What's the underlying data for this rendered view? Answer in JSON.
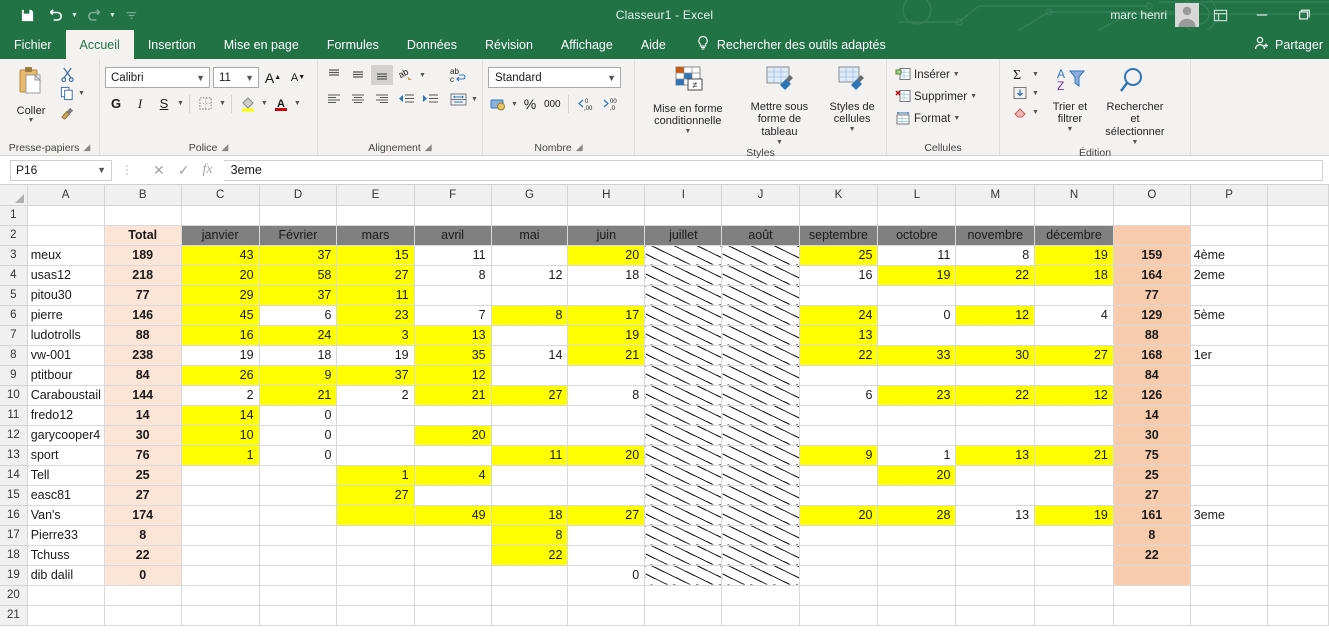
{
  "window": {
    "title": "Classeur1  -  Excel",
    "user": "marc henri",
    "qat": [
      {
        "name": "save",
        "label": "Enregistrer"
      },
      {
        "name": "undo",
        "label": "Annuler"
      },
      {
        "name": "redo",
        "label": "Rétablir"
      },
      {
        "name": "customize",
        "label": "Personnaliser la barre d'outils Accès rapide"
      }
    ],
    "controls": [
      {
        "name": "ribbon-display-options",
        "label": "Options d'affichage du ruban"
      },
      {
        "name": "minimize",
        "label": "Réduire"
      },
      {
        "name": "maximize",
        "label": "Agrandir"
      }
    ]
  },
  "tabs": [
    {
      "label": "Fichier",
      "active": false
    },
    {
      "label": "Accueil",
      "active": true
    },
    {
      "label": "Insertion",
      "active": false
    },
    {
      "label": "Mise en page",
      "active": false
    },
    {
      "label": "Formules",
      "active": false
    },
    {
      "label": "Données",
      "active": false
    },
    {
      "label": "Révision",
      "active": false
    },
    {
      "label": "Affichage",
      "active": false
    },
    {
      "label": "Aide",
      "active": false
    }
  ],
  "tellme": "Rechercher des outils adaptés",
  "share": "Partager",
  "ribbon": {
    "clipboard": {
      "group_label": "Presse-papiers",
      "paste": "Coller",
      "cut": "Couper",
      "copy": "Copier",
      "format_painter": "Reproduire la mise en forme"
    },
    "font": {
      "group_label": "Police",
      "font_name": "Calibri",
      "font_size": "11",
      "grow": "Agrandir la police",
      "shrink": "Réduire la police",
      "bold": "G",
      "italic": "I",
      "underline": "S",
      "borders": "Bordures",
      "fill_color": "Couleur de remplissage",
      "font_color": "Couleur de police"
    },
    "alignment": {
      "group_label": "Alignement",
      "wrap_text": "Renvoyer à la ligne automatiquement",
      "merge": "Fusionner et centrer"
    },
    "number": {
      "group_label": "Nombre",
      "format": "Standard",
      "accounting": "Format Comptabilité",
      "percent": "%",
      "thousands": "000",
      "inc_decimal": "Ajouter une décimale",
      "dec_decimal": "Réduire les décimales"
    },
    "styles": {
      "group_label": "Styles",
      "conditional": "Mise en forme conditionnelle",
      "table": "Mettre sous forme de tableau",
      "cellstyles": "Styles de cellules"
    },
    "cells": {
      "group_label": "Cellules",
      "insert": "Insérer",
      "delete": "Supprimer",
      "format": "Format"
    },
    "editing": {
      "group_label": "Édition",
      "autosum": "Somme automatique",
      "fill": "Remplissage",
      "clear": "Effacer",
      "sort_filter": "Trier et filtrer",
      "find_select": "Rechercher et sélectionner"
    }
  },
  "formula_bar": {
    "name_box": "P16",
    "cancel": "✕",
    "enter": "✓",
    "insert_function": "fx",
    "value": "3eme"
  },
  "sheet": {
    "columns": [
      "A",
      "B",
      "C",
      "D",
      "E",
      "F",
      "G",
      "H",
      "I",
      "J",
      "K",
      "L",
      "M",
      "N",
      "O",
      "P"
    ],
    "rows": [
      "1",
      "2",
      "3",
      "4",
      "5",
      "6",
      "7",
      "8",
      "9",
      "10",
      "11",
      "12",
      "13",
      "14",
      "15",
      "16",
      "17",
      "18",
      "19",
      "20",
      "21"
    ],
    "header_row": {
      "total_label": "Total",
      "months": [
        "janvier",
        "Février",
        "mars",
        "avril",
        "mai",
        "juin",
        "juillet",
        "août",
        "septembre",
        "octobre",
        "novembre",
        "décembre"
      ]
    },
    "data": [
      {
        "name": "meux",
        "total": "189",
        "months": [
          "43",
          "37",
          "15",
          "11",
          "",
          "20",
          "",
          "",
          "25",
          "11",
          "8",
          "19"
        ],
        "hl": [
          true,
          true,
          true,
          false,
          false,
          true,
          false,
          false,
          true,
          false,
          false,
          true
        ],
        "grand": "159",
        "rank": "4ème"
      },
      {
        "name": "usas12",
        "total": "218",
        "months": [
          "20",
          "58",
          "27",
          "8",
          "12",
          "18",
          "",
          "",
          "16",
          "19",
          "22",
          "18"
        ],
        "hl": [
          true,
          true,
          true,
          false,
          false,
          false,
          false,
          false,
          false,
          true,
          true,
          true
        ],
        "grand": "164",
        "rank": "2eme"
      },
      {
        "name": "pitou30",
        "total": "77",
        "months": [
          "29",
          "37",
          "11",
          "",
          "",
          "",
          "",
          "",
          "",
          "",
          "",
          ""
        ],
        "hl": [
          true,
          true,
          true,
          false,
          false,
          false,
          false,
          false,
          false,
          false,
          false,
          false
        ],
        "grand": "77",
        "rank": ""
      },
      {
        "name": "pierre",
        "total": "146",
        "months": [
          "45",
          "6",
          "23",
          "7",
          "8",
          "17",
          "",
          "",
          "24",
          "0",
          "12",
          "4"
        ],
        "hl": [
          true,
          false,
          true,
          false,
          true,
          true,
          false,
          false,
          true,
          false,
          true,
          false
        ],
        "grand": "129",
        "rank": "5ème"
      },
      {
        "name": "ludotrolls",
        "total": "88",
        "months": [
          "16",
          "24",
          "3",
          "13",
          "",
          "19",
          "",
          "",
          "13",
          "",
          "",
          ""
        ],
        "hl": [
          true,
          true,
          true,
          true,
          false,
          true,
          false,
          false,
          true,
          false,
          false,
          false
        ],
        "grand": "88",
        "rank": ""
      },
      {
        "name": "vw-001",
        "total": "238",
        "months": [
          "19",
          "18",
          "19",
          "35",
          "14",
          "21",
          "",
          "",
          "22",
          "33",
          "30",
          "27"
        ],
        "hl": [
          false,
          false,
          false,
          true,
          false,
          true,
          false,
          false,
          true,
          true,
          true,
          true
        ],
        "grand": "168",
        "rank": "1er"
      },
      {
        "name": "ptitbour",
        "total": "84",
        "months": [
          "26",
          "9",
          "37",
          "12",
          "",
          "",
          "",
          "",
          "",
          "",
          "",
          ""
        ],
        "hl": [
          true,
          true,
          true,
          true,
          false,
          false,
          false,
          false,
          false,
          false,
          false,
          false
        ],
        "grand": "84",
        "rank": ""
      },
      {
        "name": "Caraboustail",
        "total": "144",
        "months": [
          "2",
          "21",
          "2",
          "21",
          "27",
          "8",
          "",
          "",
          "6",
          "23",
          "22",
          "12"
        ],
        "hl": [
          false,
          true,
          false,
          true,
          true,
          false,
          false,
          false,
          false,
          true,
          true,
          true
        ],
        "grand": "126",
        "rank": ""
      },
      {
        "name": "fredo12",
        "total": "14",
        "months": [
          "14",
          "0",
          "",
          "",
          "",
          "",
          "",
          "",
          "",
          "",
          "",
          ""
        ],
        "hl": [
          true,
          false,
          false,
          false,
          false,
          false,
          false,
          false,
          false,
          false,
          false,
          false
        ],
        "grand": "14",
        "rank": ""
      },
      {
        "name": "garycooper4",
        "total": "30",
        "months": [
          "10",
          "0",
          "",
          "20",
          "",
          "",
          "",
          "",
          "",
          "",
          "",
          ""
        ],
        "hl": [
          true,
          false,
          false,
          true,
          false,
          false,
          false,
          false,
          false,
          false,
          false,
          false
        ],
        "grand": "30",
        "rank": ""
      },
      {
        "name": "sport",
        "total": "76",
        "months": [
          "1",
          "0",
          "",
          "",
          "11",
          "20",
          "",
          "",
          "9",
          "1",
          "13",
          "21"
        ],
        "hl": [
          true,
          false,
          false,
          false,
          true,
          true,
          false,
          false,
          true,
          false,
          true,
          true
        ],
        "grand": "75",
        "rank": ""
      },
      {
        "name": "Tell",
        "total": "25",
        "months": [
          "",
          "",
          "1",
          "4",
          "",
          "",
          "",
          "",
          "",
          "20",
          "",
          ""
        ],
        "hl": [
          false,
          false,
          true,
          true,
          false,
          false,
          false,
          false,
          false,
          true,
          false,
          false
        ],
        "grand": "25",
        "rank": ""
      },
      {
        "name": "easc81",
        "total": "27",
        "months": [
          "",
          "",
          "27",
          "",
          "",
          "",
          "",
          "",
          "",
          "",
          "",
          ""
        ],
        "hl": [
          false,
          false,
          true,
          false,
          false,
          false,
          false,
          false,
          false,
          false,
          false,
          false
        ],
        "grand": "27",
        "rank": ""
      },
      {
        "name": "Van's",
        "total": "174",
        "months": [
          "",
          "",
          "",
          "49",
          "18",
          "27",
          "",
          "",
          "20",
          "28",
          "13",
          "19"
        ],
        "hl": [
          false,
          false,
          true,
          true,
          true,
          true,
          false,
          false,
          true,
          true,
          false,
          true
        ],
        "grand": "161",
        "rank": "3eme"
      },
      {
        "name": "Pierre33",
        "total": "8",
        "months": [
          "",
          "",
          "",
          "",
          "8",
          "",
          "",
          "",
          "",
          "",
          "",
          ""
        ],
        "hl": [
          false,
          false,
          false,
          false,
          true,
          false,
          false,
          false,
          false,
          false,
          false,
          false
        ],
        "grand": "8",
        "rank": ""
      },
      {
        "name": "Tchuss",
        "total": "22",
        "months": [
          "",
          "",
          "",
          "",
          "22",
          "",
          "",
          "",
          "",
          "",
          "",
          ""
        ],
        "hl": [
          false,
          false,
          false,
          false,
          true,
          false,
          false,
          false,
          false,
          false,
          false,
          false
        ],
        "grand": "22",
        "rank": ""
      },
      {
        "name": "dib dalil",
        "total": "0",
        "months": [
          "",
          "",
          "",
          "",
          "",
          "0",
          "",
          "",
          "",
          "",
          "",
          ""
        ],
        "hl": [
          false,
          false,
          false,
          false,
          false,
          false,
          false,
          false,
          false,
          false,
          false,
          false
        ],
        "grand": "",
        "rank": ""
      }
    ]
  },
  "colors": {
    "excel_green": "#217346",
    "highlight_yellow": "#ffff00",
    "total_peach": "#fce4d6",
    "total_red": "#c00000",
    "month_gray": "#808080",
    "grand_peach": "#f8cbad"
  }
}
